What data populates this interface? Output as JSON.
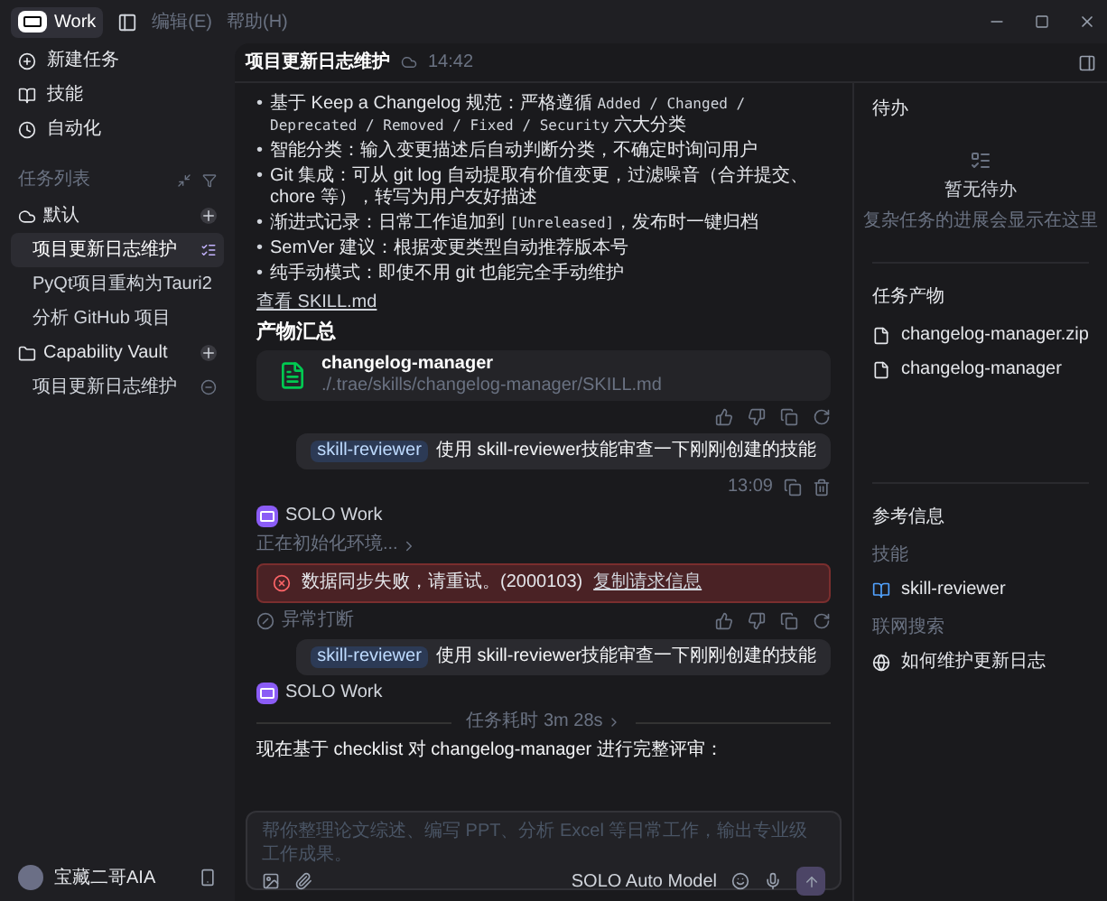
{
  "titlebar": {
    "app_name": "Work",
    "menus": [
      "编辑(E)",
      "帮助(H)"
    ]
  },
  "sidebar": {
    "nav": [
      {
        "label": "新建任务"
      },
      {
        "label": "技能"
      },
      {
        "label": "自动化"
      }
    ],
    "section_title": "任务列表",
    "groups": [
      {
        "name": "默认",
        "kind": "cloud",
        "children": [
          {
            "label": "项目更新日志维护",
            "selected": true,
            "kind": "active"
          },
          {
            "label": "PyQt项目重构为Tauri2",
            "selected": false,
            "kind": "task"
          },
          {
            "label": "分析 GitHub 项目",
            "selected": false,
            "kind": "task"
          }
        ]
      },
      {
        "name": "Capability Vault",
        "kind": "folder",
        "children": [
          {
            "label": "项目更新日志维护",
            "selected": false,
            "kind": "removable"
          }
        ]
      }
    ],
    "user": {
      "name": "宝藏二哥AIA"
    }
  },
  "chat": {
    "title": "项目更新日志维护",
    "time": "14:42",
    "bullet_marker": "•",
    "bullets": [
      [
        {
          "kind": "text",
          "text": "基于 Keep a Changelog 规范：严格遵循 "
        },
        {
          "kind": "code",
          "text": "Added / Changed / Deprecated / Removed / Fixed / Security"
        },
        {
          "kind": "text",
          "text": " 六大分类"
        }
      ],
      [
        {
          "kind": "text",
          "text": "智能分类：输入变更描述后自动判断分类，不确定时询问用户"
        }
      ],
      [
        {
          "kind": "text",
          "text": "Git 集成：可从 git log 自动提取有价值变更，过滤噪音（合并提交、chore 等），转写为用户友好描述"
        }
      ],
      [
        {
          "kind": "text",
          "text": "渐进式记录：日常工作追加到 "
        },
        {
          "kind": "code",
          "text": "[Unreleased]"
        },
        {
          "kind": "text",
          "text": "，发布时一键归档"
        }
      ],
      [
        {
          "kind": "text",
          "text": "SemVer 建议：根据变更类型自动推荐版本号"
        }
      ],
      [
        {
          "kind": "text",
          "text": "纯手动模式：即使不用 git 也能完全手动维护"
        }
      ]
    ],
    "link": "查看 SKILL.md",
    "artifacts_heading": "产物汇总",
    "file_card": {
      "name": "changelog-manager",
      "path": "./.trae/skills/changelog-manager/SKILL.md"
    },
    "messages": [
      {
        "kind": "user",
        "tag": "skill-reviewer",
        "text": "使用 skill-reviewer技能审查一下刚刚创建的技能",
        "time": "13:09"
      },
      {
        "kind": "agent",
        "name": "SOLO Work",
        "status": "正在初始化环境...",
        "error": "数据同步失败，请重试。(2000103)",
        "error_link": "复制请求信息",
        "note": "异常打断"
      },
      {
        "kind": "user",
        "tag": "skill-reviewer",
        "text": "使用 skill-reviewer技能审查一下刚刚创建的技能"
      },
      {
        "kind": "agent",
        "name": "SOLO Work",
        "duration": "任务耗时 3m 28s",
        "reply": "现在基于 checklist 对 changelog-manager 进行完整评审："
      }
    ],
    "input": {
      "placeholder": "帮你整理论文综述、编写 PPT、分析 Excel 等日常工作，输出专业级工作成果。",
      "model": "SOLO Auto Model"
    }
  },
  "right_panel": {
    "todo_title": "待办",
    "todo_empty": "暂无待办",
    "todo_hint": "复杂任务的进展会显示在这里",
    "outputs_title": "任务产物",
    "outputs": [
      "changelog-manager.zip",
      "changelog-manager"
    ],
    "ref_title": "参考信息",
    "refs": [
      {
        "heading": "技能",
        "items": [
          {
            "kind": "skill",
            "label": "skill-reviewer"
          }
        ]
      },
      {
        "heading": "联网搜索",
        "items": [
          {
            "kind": "web",
            "label": "如何维护更新日志"
          }
        ]
      }
    ]
  }
}
